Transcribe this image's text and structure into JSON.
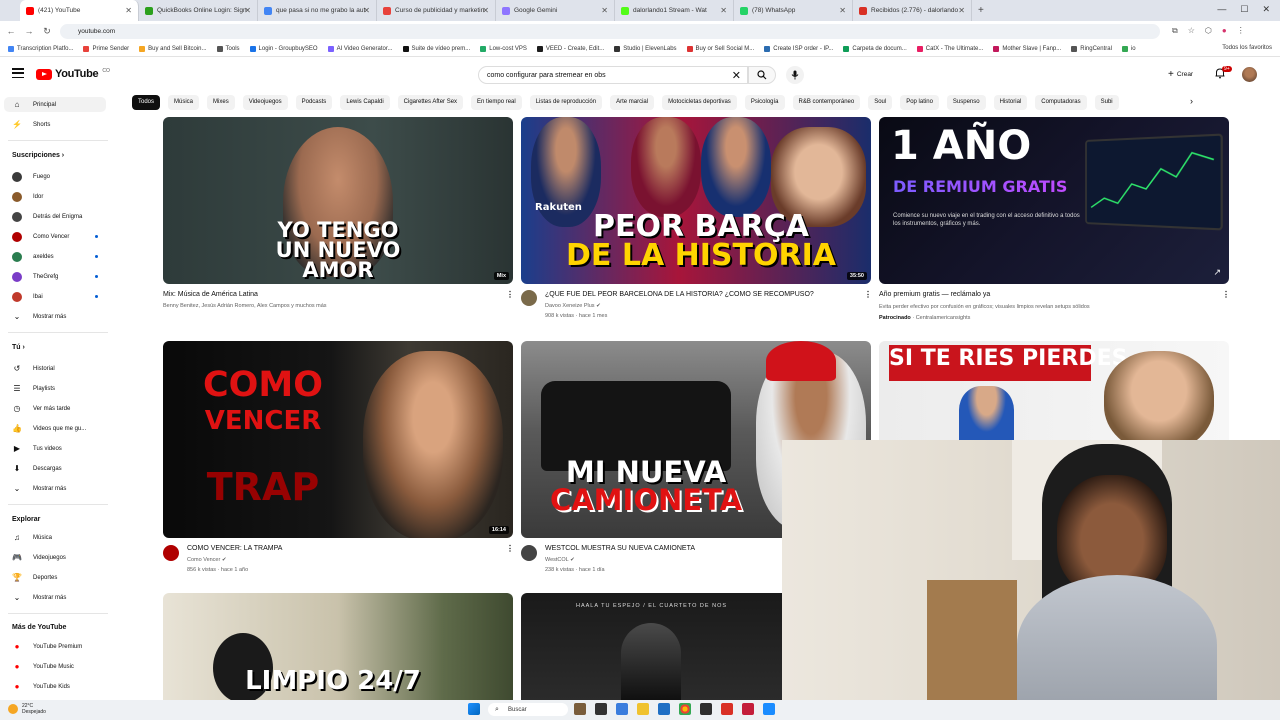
{
  "browser": {
    "tabs": [
      {
        "label": "(421) YouTube",
        "color": "#ff0000",
        "active": true
      },
      {
        "label": "QuickBooks Online Login: Sign",
        "color": "#2ca01c"
      },
      {
        "label": "que pasa si no me grabo la aut",
        "color": "#4285f4"
      },
      {
        "label": "Curso de publicidad y marketin",
        "color": "#e8423b"
      },
      {
        "label": "Google Gemini",
        "color": "#8e75ff"
      },
      {
        "label": "dalorlando1 Stream - Wat",
        "color": "#53fc18"
      },
      {
        "label": "(78) WhatsApp",
        "color": "#25d366"
      },
      {
        "label": "Recibidos (2.776) - dalorlando",
        "color": "#d93025"
      }
    ],
    "new_tab": "+",
    "url": "youtube.com",
    "bookmarks": [
      "Transcription Platfo...",
      "Prime Sender",
      "Buy and Sell Bitcoin...",
      "Tools",
      "Login - GroupbuySEO",
      "AI Video Generator...",
      "Suite de vídeo prem...",
      "Low-cost VPS",
      "VEED - Create, Edit...",
      "Studio | ElevenLabs",
      "Buy or Sell Social M...",
      "Create ISP order - IP...",
      "Carpeta de docum...",
      "CatX - The Ultimate...",
      "Mother Slave | Fanp...",
      "RingCentral",
      "io"
    ],
    "bookmarks_right": "Todos los favoritos"
  },
  "youtube": {
    "logo_text": "YouTube",
    "logo_sup": "CO",
    "search_value": "como configurar para stremear en obs",
    "create_label": "Crear",
    "notif_count": "9+",
    "chips": [
      "Todos",
      "Música",
      "Mixes",
      "Videojuegos",
      "Podcasts",
      "Lewis Capaldi",
      "Cigarettes After Sex",
      "En tiempo real",
      "Listas de reproducción",
      "Arte marcial",
      "Motocicletas deportivas",
      "Psicología",
      "R&B contemporáneo",
      "Soul",
      "Pop latino",
      "Suspenso",
      "Historial",
      "Computadoras",
      "Subi"
    ]
  },
  "sidebar": {
    "principal": "Principal",
    "shorts": "Shorts",
    "subs_title": "Suscripciones",
    "subs": [
      {
        "label": "Fuego",
        "color": "#3a3a3a"
      },
      {
        "label": "Idor",
        "color": "#8a5a2b"
      },
      {
        "label": "Detrás del Enigma",
        "color": "#444"
      },
      {
        "label": "Como Vencer",
        "color": "#b00000",
        "dot": true
      },
      {
        "label": "axeldes",
        "color": "#2a7d4f",
        "dot": true
      },
      {
        "label": "TheGrefg",
        "color": "#7a3cc7",
        "dot": true
      },
      {
        "label": "Ibai",
        "color": "#c0392b",
        "dot": true
      }
    ],
    "show_more": "Mostrar más",
    "you_title": "Tú",
    "you_items": [
      "Historial",
      "Playlists",
      "Ver más tarde",
      "Videos que me gu...",
      "Tus videos",
      "Descargas"
    ],
    "show_more2": "Mostrar más",
    "explore_title": "Explorar",
    "explore_items": [
      "Música",
      "Videojuegos",
      "Deportes"
    ],
    "show_more3": "Mostrar más",
    "more_title": "Más de YouTube",
    "more_items": [
      "YouTube Premium",
      "YouTube Music",
      "YouTube Kids"
    ]
  },
  "videos": [
    {
      "title": "Mix: Música de América Latina",
      "meta1": "Benny Benitez, Jesús Adrián Romero, Alex Campos y muchos más",
      "meta2": "",
      "duration": "Mix",
      "thumb_text": "YO TENGO\nUN NUEVO\nAMOR"
    },
    {
      "title": "¿QUE FUE DEL PEOR BARCELONA DE LA HISTORIA? ¿COMO SE RECOMPUSO?",
      "meta1": "Davoo Xeneize Plus",
      "meta2": "908 k vistas · hace 1 mes",
      "duration": "35:50",
      "thumb_text": "PEOR BARÇA\nDE LA HISTORIA",
      "thumb_top": "Rakuten"
    },
    {
      "title": "Año premium gratis — reclámalo ya",
      "meta1": "Evita perder efectivo por confusión en gráficos; visuales limpios revelan setups sólidos",
      "meta2_bold": "Patrocinado",
      "meta2": "Centralamericansights",
      "thumb_big": "1 AÑO",
      "thumb_sub": "DE REMIUM GRATIS",
      "thumb_small": "Comience su nuevo viaje en el trading con el acceso definitivo a todos los instrumentos, gráficos y más."
    },
    {
      "title": "COMO VENCER: LA TRAMPA",
      "meta1": "Como Vencer",
      "meta2": "856 k vistas · hace 1 año",
      "duration": "16:14",
      "thumb_text": "COMO\nVENCER",
      "thumb_text2": "TRAP"
    },
    {
      "title": "WESTCOL MUESTRA SU NUEVA CAMIONETA",
      "meta1": "WestCOL",
      "meta2": "238 k vistas · hace 1 día",
      "thumb_text": "MI NUEVA\nCAMIONETA"
    },
    {
      "title": "",
      "thumb_text": "SI TE RIES PIERDES"
    },
    {
      "title": "",
      "thumb_text": "LIMPIO 24/7"
    },
    {
      "title": "",
      "thumb_text": "HAALA TU ESPEJO / EL CUARTETO DE NOS"
    }
  ],
  "taskbar": {
    "weather_temp": "22°C",
    "weather_desc": "Despejado",
    "search_label": "Buscar"
  }
}
